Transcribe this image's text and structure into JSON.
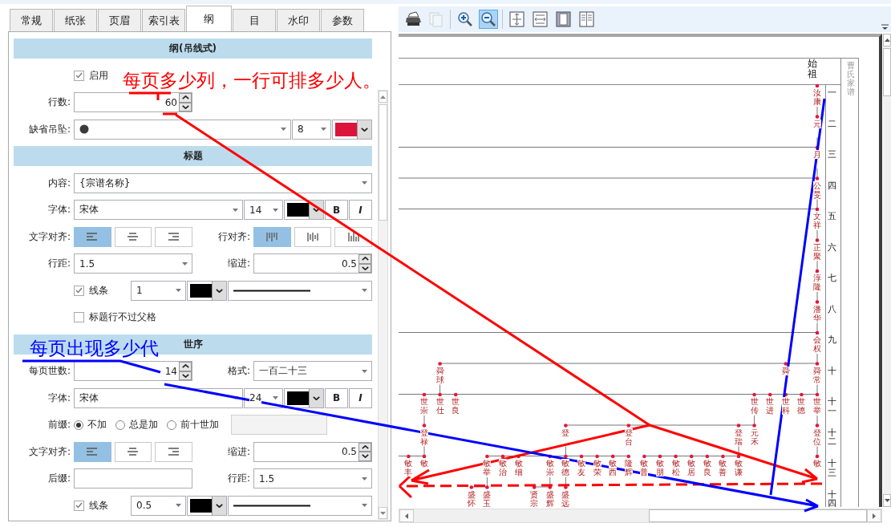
{
  "tabs": [
    {
      "label": "常规",
      "selected": false
    },
    {
      "label": "纸张",
      "selected": false
    },
    {
      "label": "页眉",
      "selected": false
    },
    {
      "label": "索引表",
      "selected": false
    },
    {
      "label": "纲",
      "selected": true
    },
    {
      "label": "目",
      "selected": false
    },
    {
      "label": "水印",
      "selected": false
    },
    {
      "label": "参数",
      "selected": false
    }
  ],
  "sections": [
    {
      "title": "纲(吊线式)",
      "rows": [
        {
          "kind": "check",
          "label": "启用",
          "checked": true
        },
        {
          "kind": "fields",
          "cells": [
            {
              "label": "行数:",
              "controls": [
                {
                  "kind": "spin",
                  "value": "60"
                }
              ]
            }
          ]
        },
        {
          "kind": "fields",
          "cells": [
            {
              "label": "缺省吊坠:",
              "controls": [
                {
                  "kind": "shape-combo"
                },
                {
                  "kind": "size-combo",
                  "value": "8"
                },
                {
                  "kind": "color",
                  "color": "#dc143c"
                }
              ]
            }
          ]
        }
      ]
    },
    {
      "title": "标题",
      "rows": [
        {
          "kind": "fields",
          "cells": [
            {
              "label": "内容:",
              "controls": [
                {
                  "kind": "combo",
                  "value": "{宗谱名称}"
                }
              ]
            }
          ]
        },
        {
          "kind": "fields",
          "cells": [
            {
              "label": "字体:",
              "controls": [
                {
                  "kind": "combo",
                  "value": "宋体"
                },
                {
                  "kind": "size-combo",
                  "value": "14"
                },
                {
                  "kind": "color",
                  "color": "#000000"
                },
                {
                  "kind": "bold",
                  "label": "B"
                },
                {
                  "kind": "italic",
                  "label": "I"
                }
              ]
            }
          ]
        },
        {
          "kind": "fields",
          "cells": [
            {
              "label": "文字对齐:",
              "controls": [
                {
                  "kind": "align",
                  "options": [
                    {
                      "selected": true
                    },
                    {
                      "selected": false
                    },
                    {
                      "selected": false
                    }
                  ]
                }
              ]
            },
            {
              "label": "行对齐:",
              "controls": [
                {
                  "kind": "row-align",
                  "options": [
                    {
                      "selected": true
                    },
                    {
                      "selected": false
                    },
                    {
                      "selected": false
                    }
                  ]
                }
              ]
            }
          ]
        },
        {
          "kind": "fields",
          "cells": [
            {
              "label": "行距:",
              "controls": [
                {
                  "kind": "combo",
                  "value": "1.5"
                }
              ]
            },
            {
              "label": "缩进:",
              "controls": [
                {
                  "kind": "spin",
                  "value": "0.5"
                }
              ]
            }
          ]
        },
        {
          "kind": "check",
          "label": "线条",
          "checked": true,
          "controls": [
            {
              "kind": "width-combo",
              "value": "1"
            },
            {
              "kind": "color",
              "color": "#000000"
            },
            {
              "kind": "line-combo"
            }
          ]
        },
        {
          "kind": "check",
          "label": "标题行不过父格",
          "checked": false
        }
      ]
    },
    {
      "title": "世序",
      "rows": [
        {
          "kind": "fields",
          "cells": [
            {
              "label": "每页世数:",
              "controls": [
                {
                  "kind": "spin",
                  "value": "14"
                }
              ]
            },
            {
              "label": "格式:",
              "controls": [
                {
                  "kind": "combo",
                  "value": "一百二十三"
                }
              ]
            }
          ]
        },
        {
          "kind": "fields",
          "cells": [
            {
              "label": "字体:",
              "controls": [
                {
                  "kind": "combo",
                  "value": "宋体"
                },
                {
                  "kind": "size-combo",
                  "value": "24"
                },
                {
                  "kind": "color",
                  "color": "#000000"
                },
                {
                  "kind": "bold",
                  "label": "B"
                },
                {
                  "kind": "italic",
                  "label": "I"
                }
              ]
            }
          ]
        },
        {
          "kind": "fields",
          "cells": [
            {
              "label": "前缀:",
              "controls": [
                {
                  "kind": "radio",
                  "label": "不加",
                  "selected": true
                },
                {
                  "kind": "radio",
                  "label": "总是加",
                  "selected": false
                },
                {
                  "kind": "radio",
                  "label": "前十世加",
                  "selected": false
                },
                {
                  "kind": "text",
                  "disabled": true
                }
              ]
            }
          ]
        },
        {
          "kind": "fields",
          "cells": [
            {
              "label": "文字对齐:",
              "controls": [
                {
                  "kind": "align",
                  "options": [
                    {
                      "selected": true
                    },
                    {
                      "selected": false
                    },
                    {
                      "selected": false
                    }
                  ]
                }
              ]
            },
            {
              "label": "缩进:",
              "controls": [
                {
                  "kind": "spin",
                  "value": "0.5"
                }
              ]
            }
          ]
        },
        {
          "kind": "fields",
          "cells": [
            {
              "label": "后缀:",
              "controls": [
                {
                  "kind": "text",
                  "disabled": false
                }
              ]
            },
            {
              "label": "行距:",
              "controls": [
                {
                  "kind": "combo",
                  "value": "1.5"
                }
              ]
            }
          ]
        },
        {
          "kind": "check",
          "label": "线条",
          "checked": true,
          "controls": [
            {
              "kind": "width-combo",
              "value": "0.5"
            },
            {
              "kind": "color",
              "color": "#000000"
            },
            {
              "kind": "line-combo"
            }
          ]
        }
      ]
    }
  ],
  "toolbar": [
    {
      "kind": "print",
      "selected": false,
      "disabled": false
    },
    {
      "kind": "copy",
      "selected": false,
      "disabled": true
    },
    {
      "kind": "zoom-in",
      "selected": false,
      "disabled": false
    },
    {
      "kind": "zoom-out",
      "selected": true,
      "disabled": false
    },
    {
      "kind": "fit-page",
      "selected": false,
      "disabled": false
    },
    {
      "kind": "fit-width",
      "selected": false,
      "disabled": false
    },
    {
      "kind": "single-page",
      "selected": false,
      "disabled": false
    },
    {
      "kind": "two-page",
      "selected": false,
      "disabled": false
    }
  ],
  "genealogy": {
    "root_label": "始祖",
    "side_title": "曹氏家谱",
    "generations": [
      {
        "label": "一",
        "names": [
          "汝康"
        ]
      },
      {
        "label": "二",
        "names": [
          "元"
        ]
      },
      {
        "label": "三",
        "names": [
          "月"
        ]
      },
      {
        "label": "四",
        "names": [
          "公旻"
        ]
      },
      {
        "label": "五",
        "names": [
          "文祥"
        ]
      },
      {
        "label": "六",
        "names": [
          "正聚"
        ]
      },
      {
        "label": "七",
        "names": [
          "淳隆"
        ]
      },
      {
        "label": "八",
        "names": [
          "潘华"
        ]
      },
      {
        "label": "九",
        "names": [
          "会权"
        ]
      },
      {
        "label": "十",
        "names": [
          "舜球",
          "舜",
          "舜常"
        ]
      },
      {
        "label": "十一",
        "names": [
          "世崇",
          "世仕",
          "世良",
          "世传",
          "世进",
          "世科",
          "世德",
          "世举"
        ]
      },
      {
        "label": "十二",
        "names": [
          "登禄",
          "登",
          "登台",
          "登瑞",
          "元禾",
          "登位"
        ]
      },
      {
        "label": "十三",
        "names": [
          "敏丰",
          "敏",
          "敏举",
          "敏治",
          "敏细",
          "敏崇",
          "敏德",
          "敏友",
          "敏荣",
          "敏西",
          "隆辉",
          "敏普",
          "敏朋",
          "敏松",
          "敏居",
          "敏良",
          "敏善",
          "敏谦",
          "敏"
        ]
      },
      {
        "label": "十四",
        "names": [
          "盛怀",
          "盛玉",
          "贤宗",
          "盛辉",
          "盛远"
        ]
      }
    ]
  },
  "annotations": [
    {
      "text": "每页多少列，一行可排多少人。",
      "color": "#ff0000"
    },
    {
      "text": "每页出现多少代",
      "color": "#0000ff"
    }
  ]
}
